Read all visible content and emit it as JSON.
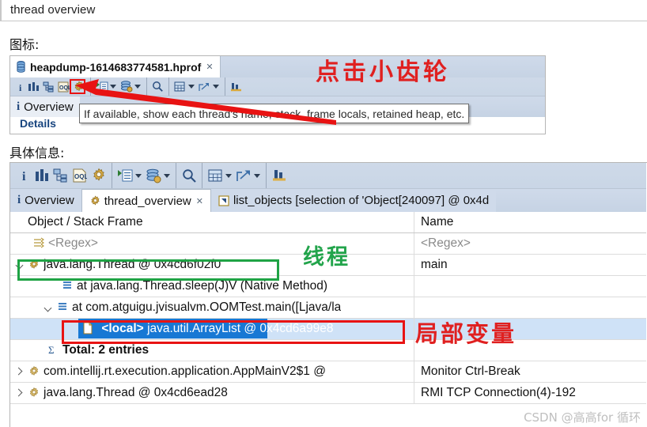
{
  "page": {
    "title": "thread overview",
    "watermark": "CSDN @高高for 循环"
  },
  "labels": {
    "icons_section": "图标:",
    "details_section": "具体信息:"
  },
  "annotations": {
    "gear_hint": "点击小齿轮",
    "thread_hint": "线程",
    "local_hint": "局部变量"
  },
  "colors": {
    "red": "#e02020",
    "green": "#22a44b",
    "selection_blue": "#1878d4",
    "row_highlight": "#cfe2f7",
    "toolbar_blue": "#ced9e8"
  },
  "icons_panel": {
    "tab": {
      "label": "heapdump-1614683774581.hprof",
      "close": "✕",
      "icon": "heapdump-icon"
    },
    "toolbar": [
      {
        "name": "info-icon",
        "glyph": "i"
      },
      {
        "name": "histogram-icon",
        "glyph": "bars"
      },
      {
        "name": "dominator-tree-icon",
        "glyph": "tree"
      },
      {
        "name": "oql-icon",
        "glyph": "OQL"
      },
      {
        "name": "thread-overview-gear-icon",
        "glyph": "gear"
      },
      {
        "name": "open-query-browser-icon",
        "glyph": "list"
      },
      {
        "name": "query-browser-caret",
        "glyph": "caret"
      },
      {
        "name": "inspect-icon",
        "glyph": "stack-gear"
      },
      {
        "name": "inspect-caret",
        "glyph": "caret"
      },
      {
        "name": "search-icon",
        "glyph": "magnifier"
      },
      {
        "name": "calculator-icon",
        "glyph": "grid"
      },
      {
        "name": "calculator-caret",
        "glyph": "caret"
      },
      {
        "name": "export-icon",
        "glyph": "export"
      },
      {
        "name": "export-caret",
        "glyph": "caret"
      },
      {
        "name": "compare-icon",
        "glyph": "compare"
      }
    ],
    "overview_tab": "Overview",
    "details_link": "Details",
    "tooltip": "If available, show each thread's name, stack, frame locals, retained heap, etc."
  },
  "details_panel": {
    "toolbar": [
      {
        "name": "info-icon",
        "glyph": "i"
      },
      {
        "name": "histogram-icon",
        "glyph": "bars"
      },
      {
        "name": "dominator-tree-icon",
        "glyph": "tree"
      },
      {
        "name": "oql-icon",
        "glyph": "OQL"
      },
      {
        "name": "thread-overview-gear-icon",
        "glyph": "gear"
      },
      {
        "name": "open-query-browser-icon",
        "glyph": "list"
      },
      {
        "name": "query-browser-caret",
        "glyph": "caret"
      },
      {
        "name": "inspect-icon",
        "glyph": "stack-gear"
      },
      {
        "name": "inspect-caret",
        "glyph": "caret"
      },
      {
        "name": "search-icon",
        "glyph": "magnifier"
      },
      {
        "name": "calculator-icon",
        "glyph": "grid"
      },
      {
        "name": "calculator-caret",
        "glyph": "caret"
      },
      {
        "name": "export-icon",
        "glyph": "export"
      },
      {
        "name": "export-caret",
        "glyph": "caret"
      },
      {
        "name": "compare-icon",
        "glyph": "compare"
      }
    ],
    "tabs": [
      {
        "label": "Overview",
        "icon": "info-icon",
        "active": false,
        "closable": false
      },
      {
        "label": "thread_overview",
        "icon": "gear-icon",
        "active": true,
        "closable": true
      },
      {
        "label": "list_objects  [selection of 'Object[240097] @ 0x4d",
        "icon": "list-objects-icon",
        "active": false,
        "closable": false
      }
    ],
    "columns": [
      "Object / Stack Frame",
      "Name"
    ],
    "filter_row": {
      "col1": "<Regex>",
      "col2": "<Regex>"
    },
    "rows": [
      {
        "indent": 0,
        "twisty": "down",
        "icon": "thread-icon",
        "text": "java.lang.Thread @ 0x4cd6f02f0",
        "name": "main",
        "bold": false,
        "selected": false
      },
      {
        "indent": 1,
        "twisty": "none",
        "icon": "stack-frame-icon",
        "text": "at java.lang.Thread.sleep(J)V (Native Method)",
        "name": "",
        "bold": false,
        "selected": false
      },
      {
        "indent": 1,
        "twisty": "down",
        "icon": "stack-frame-icon",
        "text": "at com.atguigu.jvisualvm.OOMTest.main([Ljava/la",
        "name": "",
        "bold": false,
        "selected": false
      },
      {
        "indent": 2,
        "twisty": "none",
        "icon": "local-var-icon",
        "text_bold": "<local>",
        "text": " java.util.ArrayList @ 0x4cd6a99e8",
        "name": "",
        "bold": false,
        "selected": true
      },
      {
        "indent": 1,
        "twisty": "none",
        "icon": "sigma-icon",
        "text": "Total: 2 entries",
        "name": "",
        "bold": true,
        "selected": false
      },
      {
        "indent": 0,
        "twisty": "right",
        "icon": "thread-icon",
        "text": "com.intellij.rt.execution.application.AppMainV2$1 @",
        "name": "Monitor Ctrl-Break",
        "bold": false,
        "selected": false
      },
      {
        "indent": 0,
        "twisty": "right",
        "icon": "thread-icon",
        "text": "java.lang.Thread @ 0x4cd6ead28",
        "name": "RMI TCP Connection(4)-192",
        "bold": false,
        "selected": false
      }
    ]
  }
}
